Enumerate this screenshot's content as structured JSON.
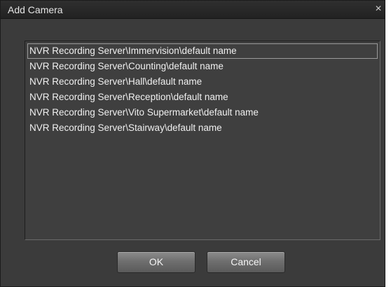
{
  "dialog": {
    "title": "Add Camera",
    "close_glyph": "×",
    "close_icon": "close-icon"
  },
  "camera_list": {
    "items": [
      "NVR Recording Server\\Immervision\\default name",
      "NVR Recording Server\\Counting\\default name",
      "NVR Recording Server\\Hall\\default name",
      "NVR Recording Server\\Reception\\default name",
      "NVR Recording Server\\Vito Supermarket\\default name",
      "NVR Recording Server\\Stairway\\default name"
    ],
    "selected_index": 0
  },
  "buttons": {
    "ok_label": "OK",
    "cancel_label": "Cancel"
  },
  "colors": {
    "dialog_background": "#3b3b3b",
    "titlebar_background": "#2a2a2a",
    "list_background": "#3f3f3f",
    "text": "#f0f0f0",
    "button": "#7a7a7a"
  }
}
